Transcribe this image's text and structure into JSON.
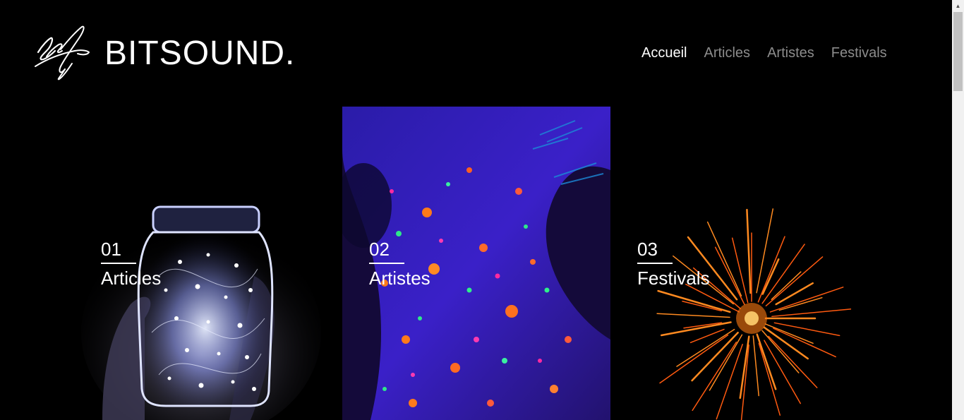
{
  "header": {
    "brand": "BITSOUND.",
    "logo_icon": "signature-icon"
  },
  "nav": {
    "items": [
      {
        "label": "Accueil",
        "active": true
      },
      {
        "label": "Articles",
        "active": false
      },
      {
        "label": "Artistes",
        "active": false
      },
      {
        "label": "Festivals",
        "active": false
      }
    ]
  },
  "cards": [
    {
      "number": "01",
      "title": "Articles",
      "image": "glowing-jar-of-lights"
    },
    {
      "number": "02",
      "title": "Artistes",
      "image": "neon-paint-splatter-skin"
    },
    {
      "number": "03",
      "title": "Festivals",
      "image": "orange-firework-burst"
    }
  ],
  "colors": {
    "background": "#000000",
    "text": "#ffffff",
    "nav_inactive": "#8c8c8c"
  }
}
